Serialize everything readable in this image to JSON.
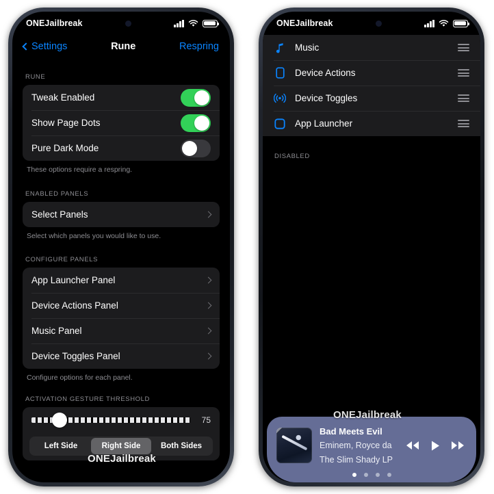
{
  "watermark": {
    "text": "ONEJailbreak"
  },
  "left_phone": {
    "status_bar": {
      "carrier": "ONEJailbreak",
      "signal_icon": "cellular-bars-icon",
      "wifi_icon": "wifi-icon",
      "battery_icon": "battery-icon"
    },
    "nav_bar": {
      "back_label": "Settings",
      "title": "Rune",
      "action_label": "Respring"
    },
    "sections": [
      {
        "header": "RUNE",
        "rows": [
          {
            "label": "Tweak Enabled",
            "control": "toggle",
            "value": "on"
          },
          {
            "label": "Show Page Dots",
            "control": "toggle",
            "value": "on"
          },
          {
            "label": "Pure Dark Mode",
            "control": "toggle",
            "value": "off"
          }
        ],
        "footer": "These options require a respring."
      },
      {
        "header": "ENABLED PANELS",
        "rows": [
          {
            "label": "Select Panels",
            "control": "disclosure"
          }
        ],
        "footer": "Select which panels you would like to use."
      },
      {
        "header": "CONFIGURE PANELS",
        "rows": [
          {
            "label": "App Launcher Panel",
            "control": "disclosure"
          },
          {
            "label": "Device Actions Panel",
            "control": "disclosure"
          },
          {
            "label": "Music Panel",
            "control": "disclosure"
          },
          {
            "label": "Device Toggles Panel",
            "control": "disclosure"
          }
        ],
        "footer": "Configure options for each panel."
      }
    ],
    "gesture": {
      "header": "ACTIVATION GESTURE THRESHOLD",
      "slider_value": "75",
      "slider_percent": 17.5,
      "segments": [
        {
          "label": "Left Side",
          "selected": false
        },
        {
          "label": "Right Side",
          "selected": true
        },
        {
          "label": "Both Sides",
          "selected": false
        }
      ]
    }
  },
  "right_phone": {
    "status_bar": {
      "carrier": "ONEJailbreak",
      "signal_icon": "cellular-bars-icon",
      "wifi_icon": "wifi-icon",
      "battery_icon": "battery-icon"
    },
    "enabled_panels": [
      {
        "label": "Music",
        "icon": "music-note-icon",
        "handle": "reorder-handle-icon"
      },
      {
        "label": "Device Actions",
        "icon": "phone-outline-icon",
        "handle": "reorder-handle-icon"
      },
      {
        "label": "Device Toggles",
        "icon": "broadcast-icon",
        "handle": "reorder-handle-icon"
      },
      {
        "label": "App Launcher",
        "icon": "rounded-square-icon",
        "handle": "reorder-handle-icon"
      }
    ],
    "disabled_header": "DISABLED",
    "music_widget": {
      "title": "Bad Meets Evil",
      "artist": "Eminem, Royce da",
      "album": "The Slim Shady LP",
      "rewind_icon": "rewind-icon",
      "play_icon": "play-icon",
      "forward_icon": "fast-forward-icon",
      "page_dots": 4,
      "active_dot": 0,
      "accent_color": "#656d96"
    }
  }
}
